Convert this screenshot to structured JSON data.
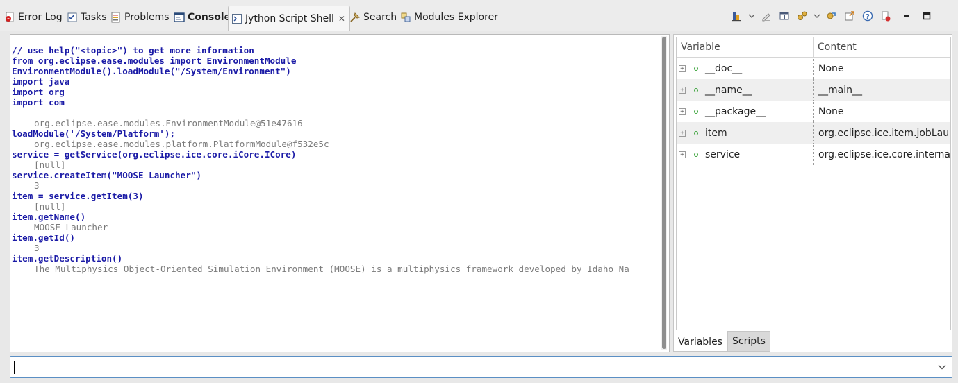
{
  "tabs": [
    {
      "label": "Error Log",
      "icon": "error-log-icon"
    },
    {
      "label": "Tasks",
      "icon": "tasks-icon"
    },
    {
      "label": "Problems",
      "icon": "problems-icon"
    },
    {
      "label": "Console",
      "icon": "console-icon"
    },
    {
      "label": "Jython Script Shell",
      "icon": "script-shell-icon",
      "close": "✕"
    },
    {
      "label": "Search",
      "icon": "search-icon"
    },
    {
      "label": "Modules Explorer",
      "icon": "modules-explorer-icon"
    }
  ],
  "toolbar_icons": [
    "run-script-icon",
    "dropdown-icon",
    "clear-icon",
    "layout-icon",
    "modules-icon",
    "dropdown-icon",
    "reload-icon",
    "export-icon",
    "help-icon",
    "terminate-icon",
    "minimize-icon",
    "maximize-icon"
  ],
  "console": {
    "lines": [
      {
        "kind": "cmd",
        "text": "// use help(\"<topic>\") to get more information"
      },
      {
        "kind": "cmd",
        "text": "from org.eclipse.ease.modules import EnvironmentModule"
      },
      {
        "kind": "cmd",
        "text": "EnvironmentModule().loadModule(\"/System/Environment\")"
      },
      {
        "kind": "cmd",
        "text": "import java"
      },
      {
        "kind": "cmd",
        "text": "import org"
      },
      {
        "kind": "cmd",
        "text": "import com"
      },
      {
        "kind": "blank",
        "text": ""
      },
      {
        "kind": "out",
        "text": "org.eclipse.ease.modules.EnvironmentModule@51e47616"
      },
      {
        "kind": "cmd",
        "text": "loadModule('/System/Platform');"
      },
      {
        "kind": "out",
        "text": "org.eclipse.ease.modules.platform.PlatformModule@f532e5c"
      },
      {
        "kind": "cmd",
        "text": "service = getService(org.eclipse.ice.core.iCore.ICore)"
      },
      {
        "kind": "out",
        "text": "[null]"
      },
      {
        "kind": "cmd",
        "text": "service.createItem(\"MOOSE Launcher\")"
      },
      {
        "kind": "out",
        "text": "3"
      },
      {
        "kind": "cmd",
        "text": "item = service.getItem(3)"
      },
      {
        "kind": "out",
        "text": "[null]"
      },
      {
        "kind": "cmd",
        "text": "item.getName()"
      },
      {
        "kind": "out",
        "text": "MOOSE Launcher"
      },
      {
        "kind": "cmd",
        "text": "item.getId()"
      },
      {
        "kind": "out",
        "text": "3"
      },
      {
        "kind": "cmd",
        "text": "item.getDescription()"
      },
      {
        "kind": "out",
        "text": "The Multiphysics Object-Oriented Simulation Environment (MOOSE) is a multiphysics framework developed by Idaho Na"
      }
    ]
  },
  "variables": {
    "headers": {
      "variable": "Variable",
      "content": "Content"
    },
    "expand_glyph": "+",
    "rows": [
      {
        "name": "__doc__",
        "content": "None"
      },
      {
        "name": "__name__",
        "content": "__main__"
      },
      {
        "name": "__package__",
        "content": "None"
      },
      {
        "name": "item",
        "content": "org.eclipse.ice.item.jobLaunch"
      },
      {
        "name": "service",
        "content": "org.eclipse.ice.core.internal.C"
      }
    ],
    "tabs": [
      "Variables",
      "Scripts"
    ]
  },
  "command_input": {
    "value": "",
    "placeholder": ""
  }
}
